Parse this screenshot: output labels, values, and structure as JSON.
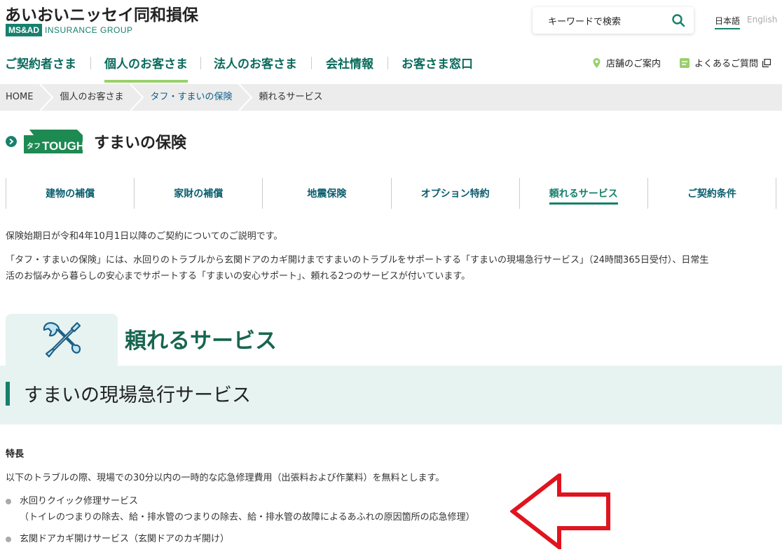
{
  "header": {
    "logo_main": "あいおいニッセイ同和損保",
    "logo_badge": "MS&AD",
    "logo_group": "INSURANCE GROUP",
    "search_placeholder": "キーワードで検索",
    "lang_ja": "日本語",
    "lang_en": "English"
  },
  "gnav": {
    "items": [
      "ご契約者さま",
      "個人のお客さま",
      "法人のお客さま",
      "会社情報",
      "お客さま窓口"
    ]
  },
  "util": {
    "store": "店舗のご案内",
    "faq": "よくあるご質問"
  },
  "breadcrumb": [
    "HOME",
    "個人のお客さま",
    "タフ・すまいの保険",
    "頼れるサービス"
  ],
  "title": {
    "logo_kana": "タフ",
    "logo_text": "TOUGH",
    "text": "すまいの保険"
  },
  "subtabs": [
    "建物の補償",
    "家財の補償",
    "地震保険",
    "オプション特約",
    "頼れるサービス",
    "ご契約条件"
  ],
  "intro": {
    "line1": "保険始期日が令和4年10月1日以降のご契約についてのご説明です。",
    "line2a": "「タフ・すまいの保険」には、水回りのトラブルから玄関ドアのカギ開けまですまいのトラブルをサポートする「すまいの現場急行サービス」（24時間365日受付）、日常生",
    "line2b": "活のお悩みから暮らしの安心までサポートする「すまいの安心サポート」、頼れる2つのサービスが付いています。"
  },
  "section": {
    "title": "頼れるサービス",
    "band_title": "すまいの現場急行サービス",
    "feature_head": "特長",
    "feature_desc": "以下のトラブルの際、現場での30分以内の一時的な応急修理費用（出張料および作業料）を無料とします。",
    "bullet1": "水回りクイック修理サービス",
    "bullet1_sub": "（トイレのつまりの除去、給・排水管のつまりの除去、給・排水管の故障によるあふれの原因箇所の応急修理）",
    "bullet2": "玄関ドアカギ開けサービス（玄関ドアのカギ開け）"
  },
  "colors": {
    "brand": "#17806d",
    "accent_green": "#9ad06b",
    "band_bg": "#e7f3f1",
    "arrow_red": "#e0141e"
  }
}
